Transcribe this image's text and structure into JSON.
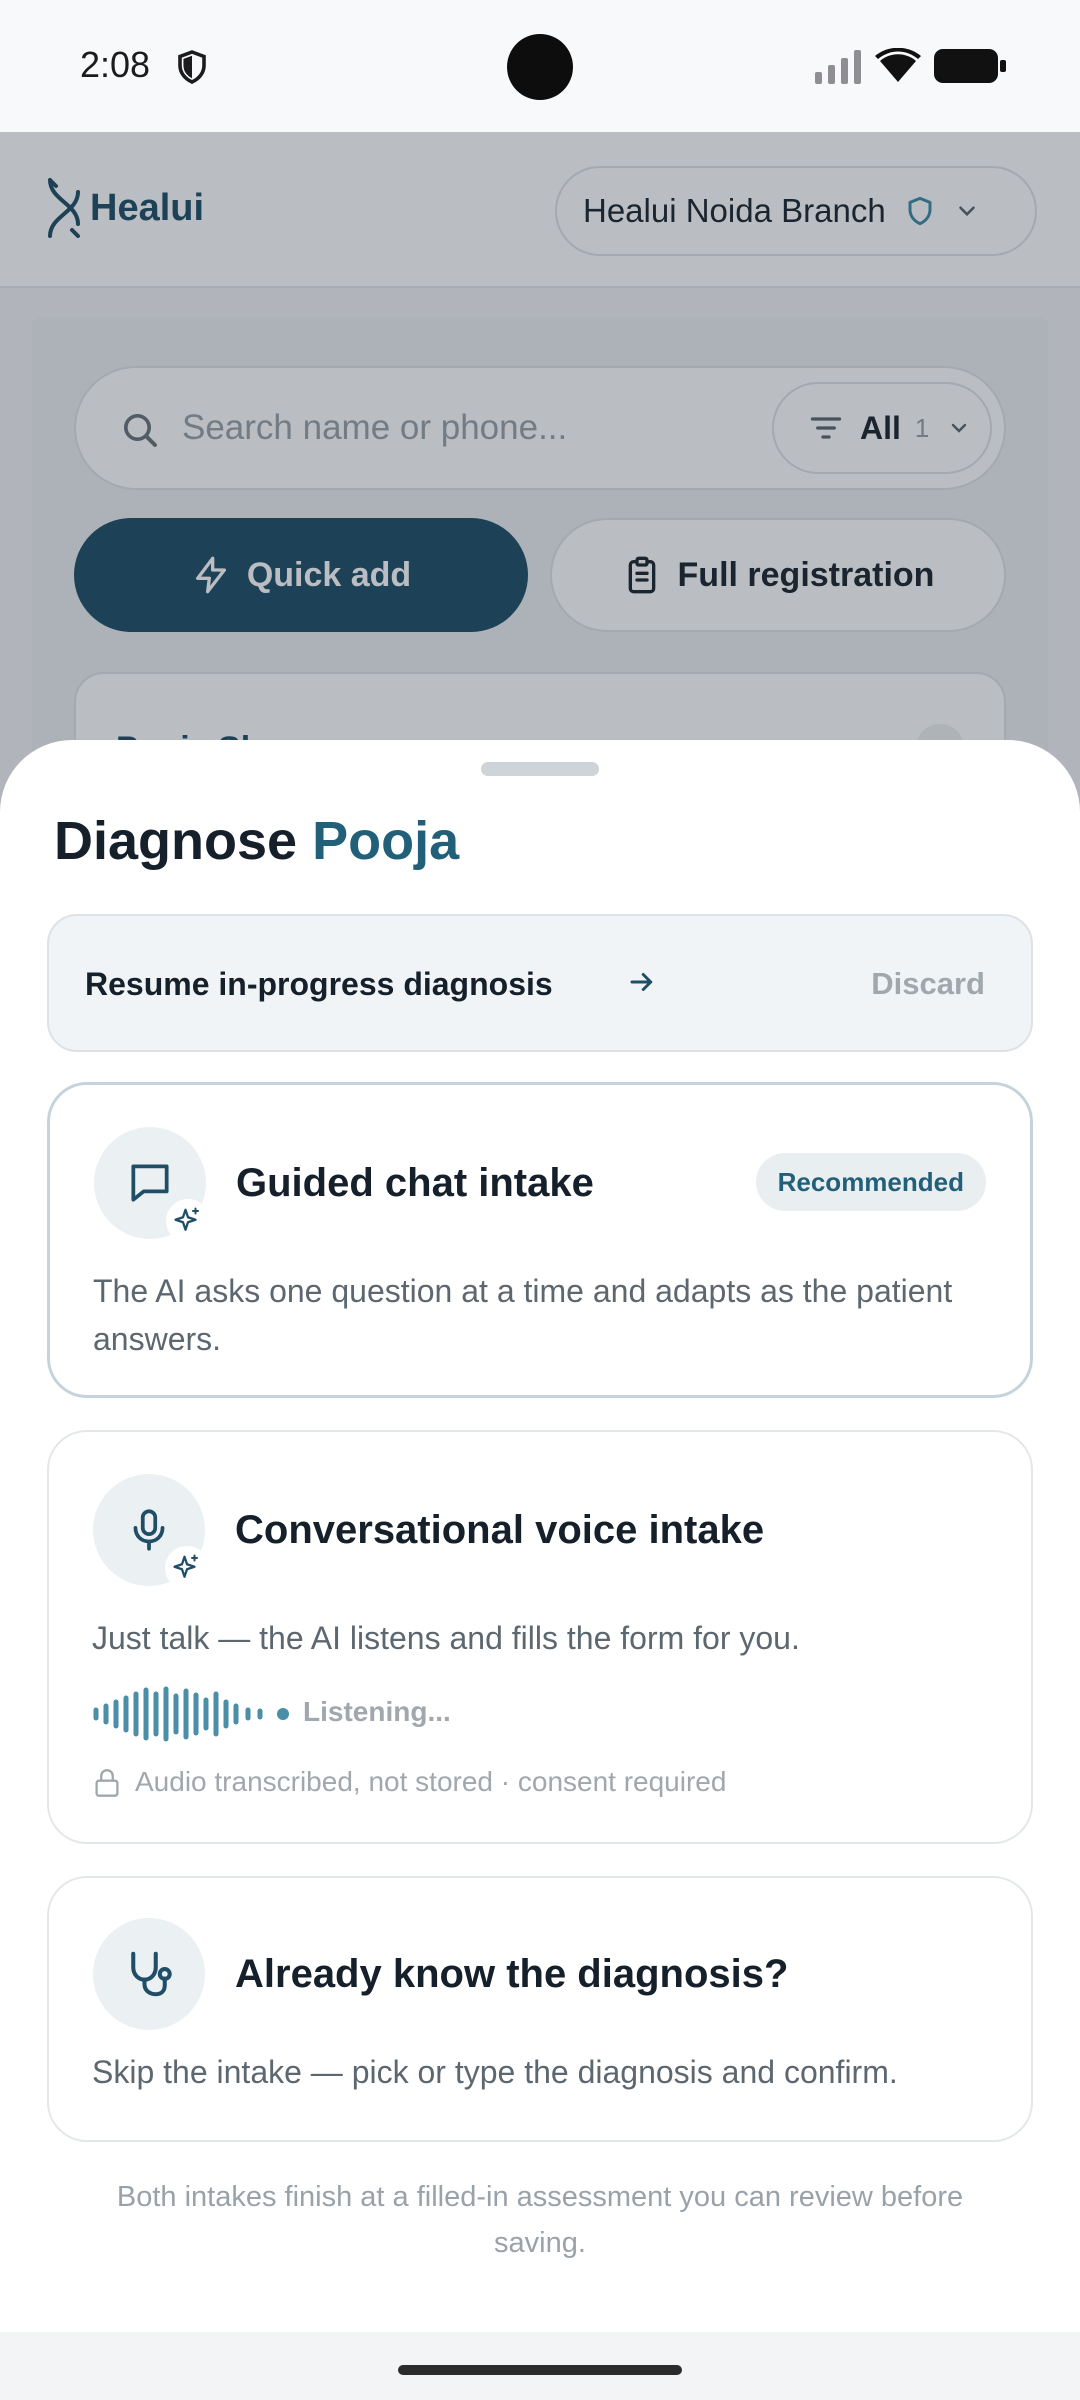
{
  "status_bar": {
    "time": "2:08"
  },
  "app": {
    "brand": "Healui",
    "branch": "Healui Noida Branch",
    "search_placeholder": "Search name or phone...",
    "filter": {
      "label": "All",
      "count": "1"
    },
    "quick_add": "Quick add",
    "full_registration": "Full registration",
    "peek_card_name": "Pooja Sharma"
  },
  "sheet": {
    "title_prefix": "Diagnose",
    "patient": "Pooja",
    "resume": {
      "label": "Resume in-progress diagnosis",
      "discard": "Discard"
    },
    "options": [
      {
        "title": "Guided chat intake",
        "badge": "Recommended",
        "description": "The AI asks one question at a time and adapts as the patient answers."
      },
      {
        "title": "Conversational voice intake",
        "description": "Just talk — the AI listens and fills the form for you.",
        "listening": "Listening...",
        "privacy": "Audio transcribed, not stored · consent required"
      },
      {
        "title": "Already know the diagnosis?",
        "description": "Skip the intake — pick or type the diagnosis and confirm."
      }
    ],
    "footnote": "Both intakes finish at a filled-in assessment you can review before saving."
  },
  "colors": {
    "primary": "#1f4e66",
    "accent": "#22607a",
    "wave": "#4a8ea8",
    "muted_text": "#a0a7ad"
  },
  "icons": [
    "shield-icon",
    "search-icon",
    "filter-icon",
    "chevron-down-icon",
    "bolt-icon",
    "clipboard-icon",
    "arrow-right-icon",
    "chat-bubble-icon",
    "sparkle-icon",
    "microphone-icon",
    "waveform-icon",
    "lock-icon",
    "stethoscope-icon"
  ]
}
